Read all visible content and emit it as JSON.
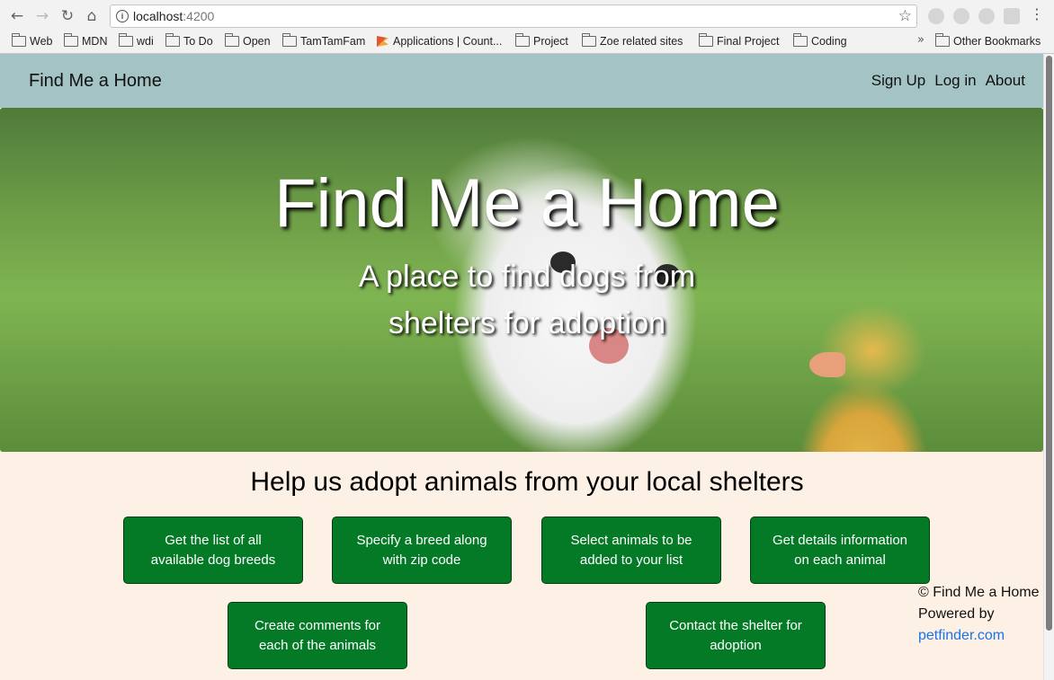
{
  "browser": {
    "url_host": "localhost",
    "url_port": ":4200",
    "bookmarks": [
      {
        "label": "Web",
        "type": "folder"
      },
      {
        "label": "MDN",
        "type": "folder"
      },
      {
        "label": "wdi",
        "type": "folder"
      },
      {
        "label": "To Do",
        "type": "folder"
      },
      {
        "label": "Open",
        "type": "folder"
      },
      {
        "label": "TamTamFam",
        "type": "folder"
      },
      {
        "label": "Applications | Count...",
        "type": "page"
      },
      {
        "label": "Project",
        "type": "folder"
      },
      {
        "label": "Zoe related sites",
        "type": "folder"
      },
      {
        "label": "Final Project",
        "type": "folder"
      },
      {
        "label": "Coding",
        "type": "folder"
      },
      {
        "label": "Other Bookmarks",
        "type": "folder"
      }
    ]
  },
  "navbar": {
    "brand": "Find Me a Home",
    "links": [
      "Sign Up",
      "Log in",
      "About"
    ]
  },
  "hero": {
    "title": "Find Me a Home",
    "subtitle": "A place to find dogs from shelters for adoption"
  },
  "content": {
    "heading": "Help us adopt animals from your local shelters",
    "cards": [
      "Get the list of all available dog breeds",
      "Specify a breed along with zip code",
      "Select animals to be added to your list",
      "Get details information on each animal",
      "Create comments for each of the animals",
      "Contact the shelter for adoption"
    ]
  },
  "footer": {
    "copyright": "© Find Me a Home",
    "powered_by": "Powered by",
    "link": "petfinder.com"
  }
}
